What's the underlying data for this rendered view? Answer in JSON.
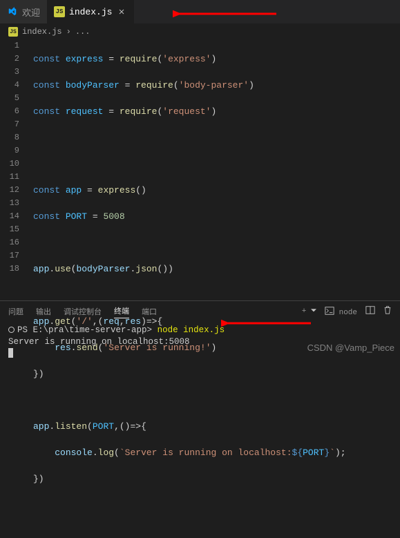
{
  "tabs": [
    {
      "label": "欢迎",
      "icon": "vscode"
    },
    {
      "label": "index.js",
      "icon": "js",
      "active": true
    }
  ],
  "breadcrumb": {
    "file": "index.js",
    "sep": "›",
    "more": "..."
  },
  "lines": [
    "1",
    "2",
    "3",
    "4",
    "5",
    "6",
    "7",
    "8",
    "9",
    "10",
    "11",
    "12",
    "13",
    "14",
    "15",
    "16",
    "17",
    "18"
  ],
  "code": {
    "l1_const": "const",
    "l1_var": "express",
    "l1_eq": " = ",
    "l1_fn": "require",
    "l1_open": "(",
    "l1_str": "'express'",
    "l1_close": ")",
    "l2_const": "const",
    "l2_var": "bodyParser",
    "l2_eq": " = ",
    "l2_fn": "require",
    "l2_open": "(",
    "l2_str": "'body-parser'",
    "l2_close": ")",
    "l3_const": "const",
    "l3_var": "request",
    "l3_eq": " = ",
    "l3_fn": "require",
    "l3_open": "(",
    "l3_str": "'request'",
    "l3_close": ")",
    "l6_const": "const",
    "l6_var": "app",
    "l6_eq": " = ",
    "l6_fn": "express",
    "l6_par": "()",
    "l7_const": "const",
    "l7_var": "PORT",
    "l7_eq": " = ",
    "l7_num": "5008",
    "l9_app": "app",
    "l9_dot": ".",
    "l9_use": "use",
    "l9_open": "(",
    "l9_bp": "bodyParser",
    "l9_dot2": ".",
    "l9_json": "json",
    "l9_par": "()",
    "l9_close": ")",
    "l11_app": "app",
    "l11_dot": ".",
    "l11_get": "get",
    "l11_open": "(",
    "l11_str": "'/'",
    "l11_comma": ",(",
    "l11_req": "req",
    "l11_c2": ",",
    "l11_res": "res",
    "l11_arrow": ")=>{",
    "l12_indent": "    ",
    "l12_res": "res",
    "l12_dot": ".",
    "l12_send": "send",
    "l12_open": "(",
    "l12_str": "'Server is running!'",
    "l12_close": ")",
    "l13": "})",
    "l15_app": "app",
    "l15_dot": ".",
    "l15_listen": "listen",
    "l15_open": "(",
    "l15_port": "PORT",
    "l15_comma": ",()=>{",
    "l16_indent": "    ",
    "l16_console": "console",
    "l16_dot": ".",
    "l16_log": "log",
    "l16_open": "(",
    "l16_tick1": "`",
    "l16_txt": "Server is running on localhost:",
    "l16_dollar": "${",
    "l16_pvar": "PORT",
    "l16_cb": "}",
    "l16_tick2": "`",
    "l16_close": ");",
    "l17": "})"
  },
  "panel": {
    "tabs": [
      "问题",
      "输出",
      "调试控制台",
      "终端",
      "端口"
    ],
    "active": 3,
    "rightLabel": "node",
    "plus": "+"
  },
  "terminal": {
    "promptPath": "PS E:\\pra\\time-server-app>",
    "command": "node index.js",
    "output": "Server is running on localhost:5008"
  },
  "watermark": "CSDN @Vamp_Piece"
}
